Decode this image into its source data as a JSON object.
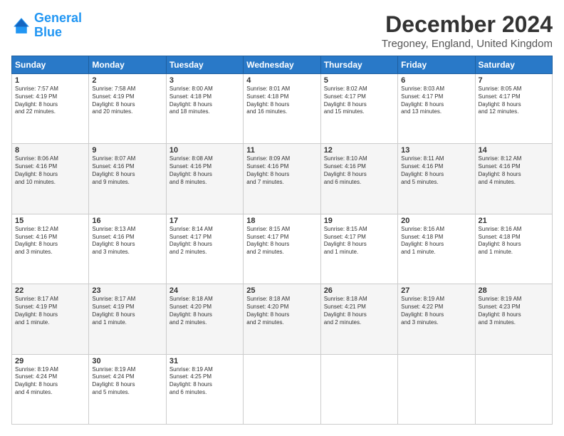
{
  "logo": {
    "line1": "General",
    "line2": "Blue"
  },
  "title": "December 2024",
  "subtitle": "Tregoney, England, United Kingdom",
  "days": [
    "Sunday",
    "Monday",
    "Tuesday",
    "Wednesday",
    "Thursday",
    "Friday",
    "Saturday"
  ],
  "weeks": [
    [
      {
        "num": "1",
        "sunrise": "7:57 AM",
        "sunset": "4:19 PM",
        "daylight": "8 hours and 22 minutes."
      },
      {
        "num": "2",
        "sunrise": "7:58 AM",
        "sunset": "4:19 PM",
        "daylight": "8 hours and 20 minutes."
      },
      {
        "num": "3",
        "sunrise": "8:00 AM",
        "sunset": "4:18 PM",
        "daylight": "8 hours and 18 minutes."
      },
      {
        "num": "4",
        "sunrise": "8:01 AM",
        "sunset": "4:18 PM",
        "daylight": "8 hours and 16 minutes."
      },
      {
        "num": "5",
        "sunrise": "8:02 AM",
        "sunset": "4:17 PM",
        "daylight": "8 hours and 15 minutes."
      },
      {
        "num": "6",
        "sunrise": "8:03 AM",
        "sunset": "4:17 PM",
        "daylight": "8 hours and 13 minutes."
      },
      {
        "num": "7",
        "sunrise": "8:05 AM",
        "sunset": "4:17 PM",
        "daylight": "8 hours and 12 minutes."
      }
    ],
    [
      {
        "num": "8",
        "sunrise": "8:06 AM",
        "sunset": "4:16 PM",
        "daylight": "8 hours and 10 minutes."
      },
      {
        "num": "9",
        "sunrise": "8:07 AM",
        "sunset": "4:16 PM",
        "daylight": "8 hours and 9 minutes."
      },
      {
        "num": "10",
        "sunrise": "8:08 AM",
        "sunset": "4:16 PM",
        "daylight": "8 hours and 8 minutes."
      },
      {
        "num": "11",
        "sunrise": "8:09 AM",
        "sunset": "4:16 PM",
        "daylight": "8 hours and 7 minutes."
      },
      {
        "num": "12",
        "sunrise": "8:10 AM",
        "sunset": "4:16 PM",
        "daylight": "8 hours and 6 minutes."
      },
      {
        "num": "13",
        "sunrise": "8:11 AM",
        "sunset": "4:16 PM",
        "daylight": "8 hours and 5 minutes."
      },
      {
        "num": "14",
        "sunrise": "8:12 AM",
        "sunset": "4:16 PM",
        "daylight": "8 hours and 4 minutes."
      }
    ],
    [
      {
        "num": "15",
        "sunrise": "8:12 AM",
        "sunset": "4:16 PM",
        "daylight": "8 hours and 3 minutes."
      },
      {
        "num": "16",
        "sunrise": "8:13 AM",
        "sunset": "4:16 PM",
        "daylight": "8 hours and 3 minutes."
      },
      {
        "num": "17",
        "sunrise": "8:14 AM",
        "sunset": "4:17 PM",
        "daylight": "8 hours and 2 minutes."
      },
      {
        "num": "18",
        "sunrise": "8:15 AM",
        "sunset": "4:17 PM",
        "daylight": "8 hours and 2 minutes."
      },
      {
        "num": "19",
        "sunrise": "8:15 AM",
        "sunset": "4:17 PM",
        "daylight": "8 hours and 1 minute."
      },
      {
        "num": "20",
        "sunrise": "8:16 AM",
        "sunset": "4:18 PM",
        "daylight": "8 hours and 1 minute."
      },
      {
        "num": "21",
        "sunrise": "8:16 AM",
        "sunset": "4:18 PM",
        "daylight": "8 hours and 1 minute."
      }
    ],
    [
      {
        "num": "22",
        "sunrise": "8:17 AM",
        "sunset": "4:19 PM",
        "daylight": "8 hours and 1 minute."
      },
      {
        "num": "23",
        "sunrise": "8:17 AM",
        "sunset": "4:19 PM",
        "daylight": "8 hours and 1 minute."
      },
      {
        "num": "24",
        "sunrise": "8:18 AM",
        "sunset": "4:20 PM",
        "daylight": "8 hours and 2 minutes."
      },
      {
        "num": "25",
        "sunrise": "8:18 AM",
        "sunset": "4:20 PM",
        "daylight": "8 hours and 2 minutes."
      },
      {
        "num": "26",
        "sunrise": "8:18 AM",
        "sunset": "4:21 PM",
        "daylight": "8 hours and 2 minutes."
      },
      {
        "num": "27",
        "sunrise": "8:19 AM",
        "sunset": "4:22 PM",
        "daylight": "8 hours and 3 minutes."
      },
      {
        "num": "28",
        "sunrise": "8:19 AM",
        "sunset": "4:23 PM",
        "daylight": "8 hours and 3 minutes."
      }
    ],
    [
      {
        "num": "29",
        "sunrise": "8:19 AM",
        "sunset": "4:24 PM",
        "daylight": "8 hours and 4 minutes."
      },
      {
        "num": "30",
        "sunrise": "8:19 AM",
        "sunset": "4:24 PM",
        "daylight": "8 hours and 5 minutes."
      },
      {
        "num": "31",
        "sunrise": "8:19 AM",
        "sunset": "4:25 PM",
        "daylight": "8 hours and 6 minutes."
      },
      null,
      null,
      null,
      null
    ]
  ],
  "labels": {
    "sunrise": "Sunrise:",
    "sunset": "Sunset:",
    "daylight": "Daylight hours"
  }
}
